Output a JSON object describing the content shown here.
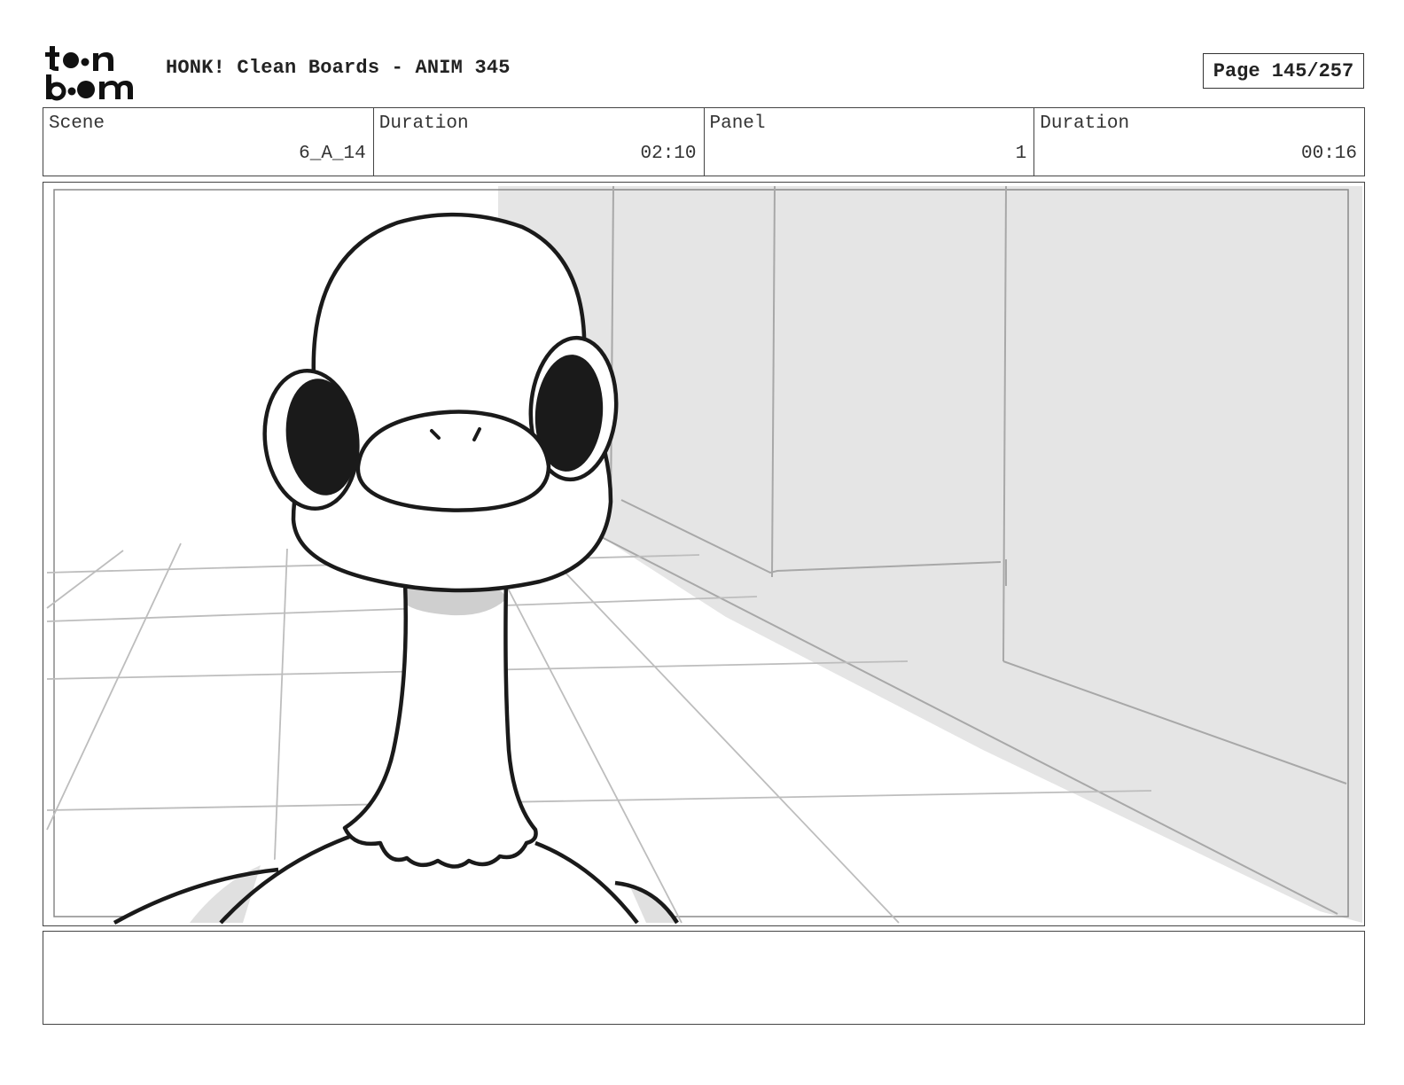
{
  "header": {
    "logo_text_top": "toon",
    "logo_text_bottom": "boom",
    "title": "HONK! Clean Boards - ANIM 345",
    "page_label": "Page 145/257"
  },
  "info": {
    "scene_label": "Scene",
    "scene_value": "6_A_14",
    "scene_duration_label": "Duration",
    "scene_duration_value": "02:10",
    "panel_label": "Panel",
    "panel_value": "1",
    "panel_duration_label": "Duration",
    "panel_duration_value": "00:16"
  },
  "notes": {
    "text": ""
  }
}
